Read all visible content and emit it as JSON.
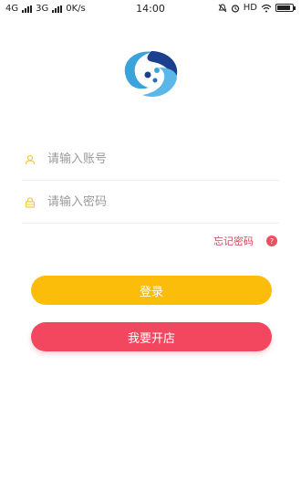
{
  "status_bar": {
    "network_1": "4G",
    "network_2": "3G",
    "speed": "0K/s",
    "time": "14:00",
    "hd": "HD",
    "battery_level": 0.85
  },
  "logo": {
    "icon": "app-logo-swirl",
    "colors": [
      "#3aa3db",
      "#1c3f8f",
      "#5bb7e8"
    ]
  },
  "form": {
    "account_placeholder": "请输入账号",
    "password_placeholder": "请输入密码",
    "account_icon": "user-icon",
    "password_icon": "lock-icon",
    "icon_color": "#f2c94c"
  },
  "forgot": {
    "label": "忘记密码",
    "badge": "?"
  },
  "buttons": {
    "login": "登录",
    "open_shop": "我要开店"
  },
  "colors": {
    "login_button": "#fbbd0a",
    "open_shop_button": "#f3475f",
    "forgot_link": "#d6475b"
  }
}
